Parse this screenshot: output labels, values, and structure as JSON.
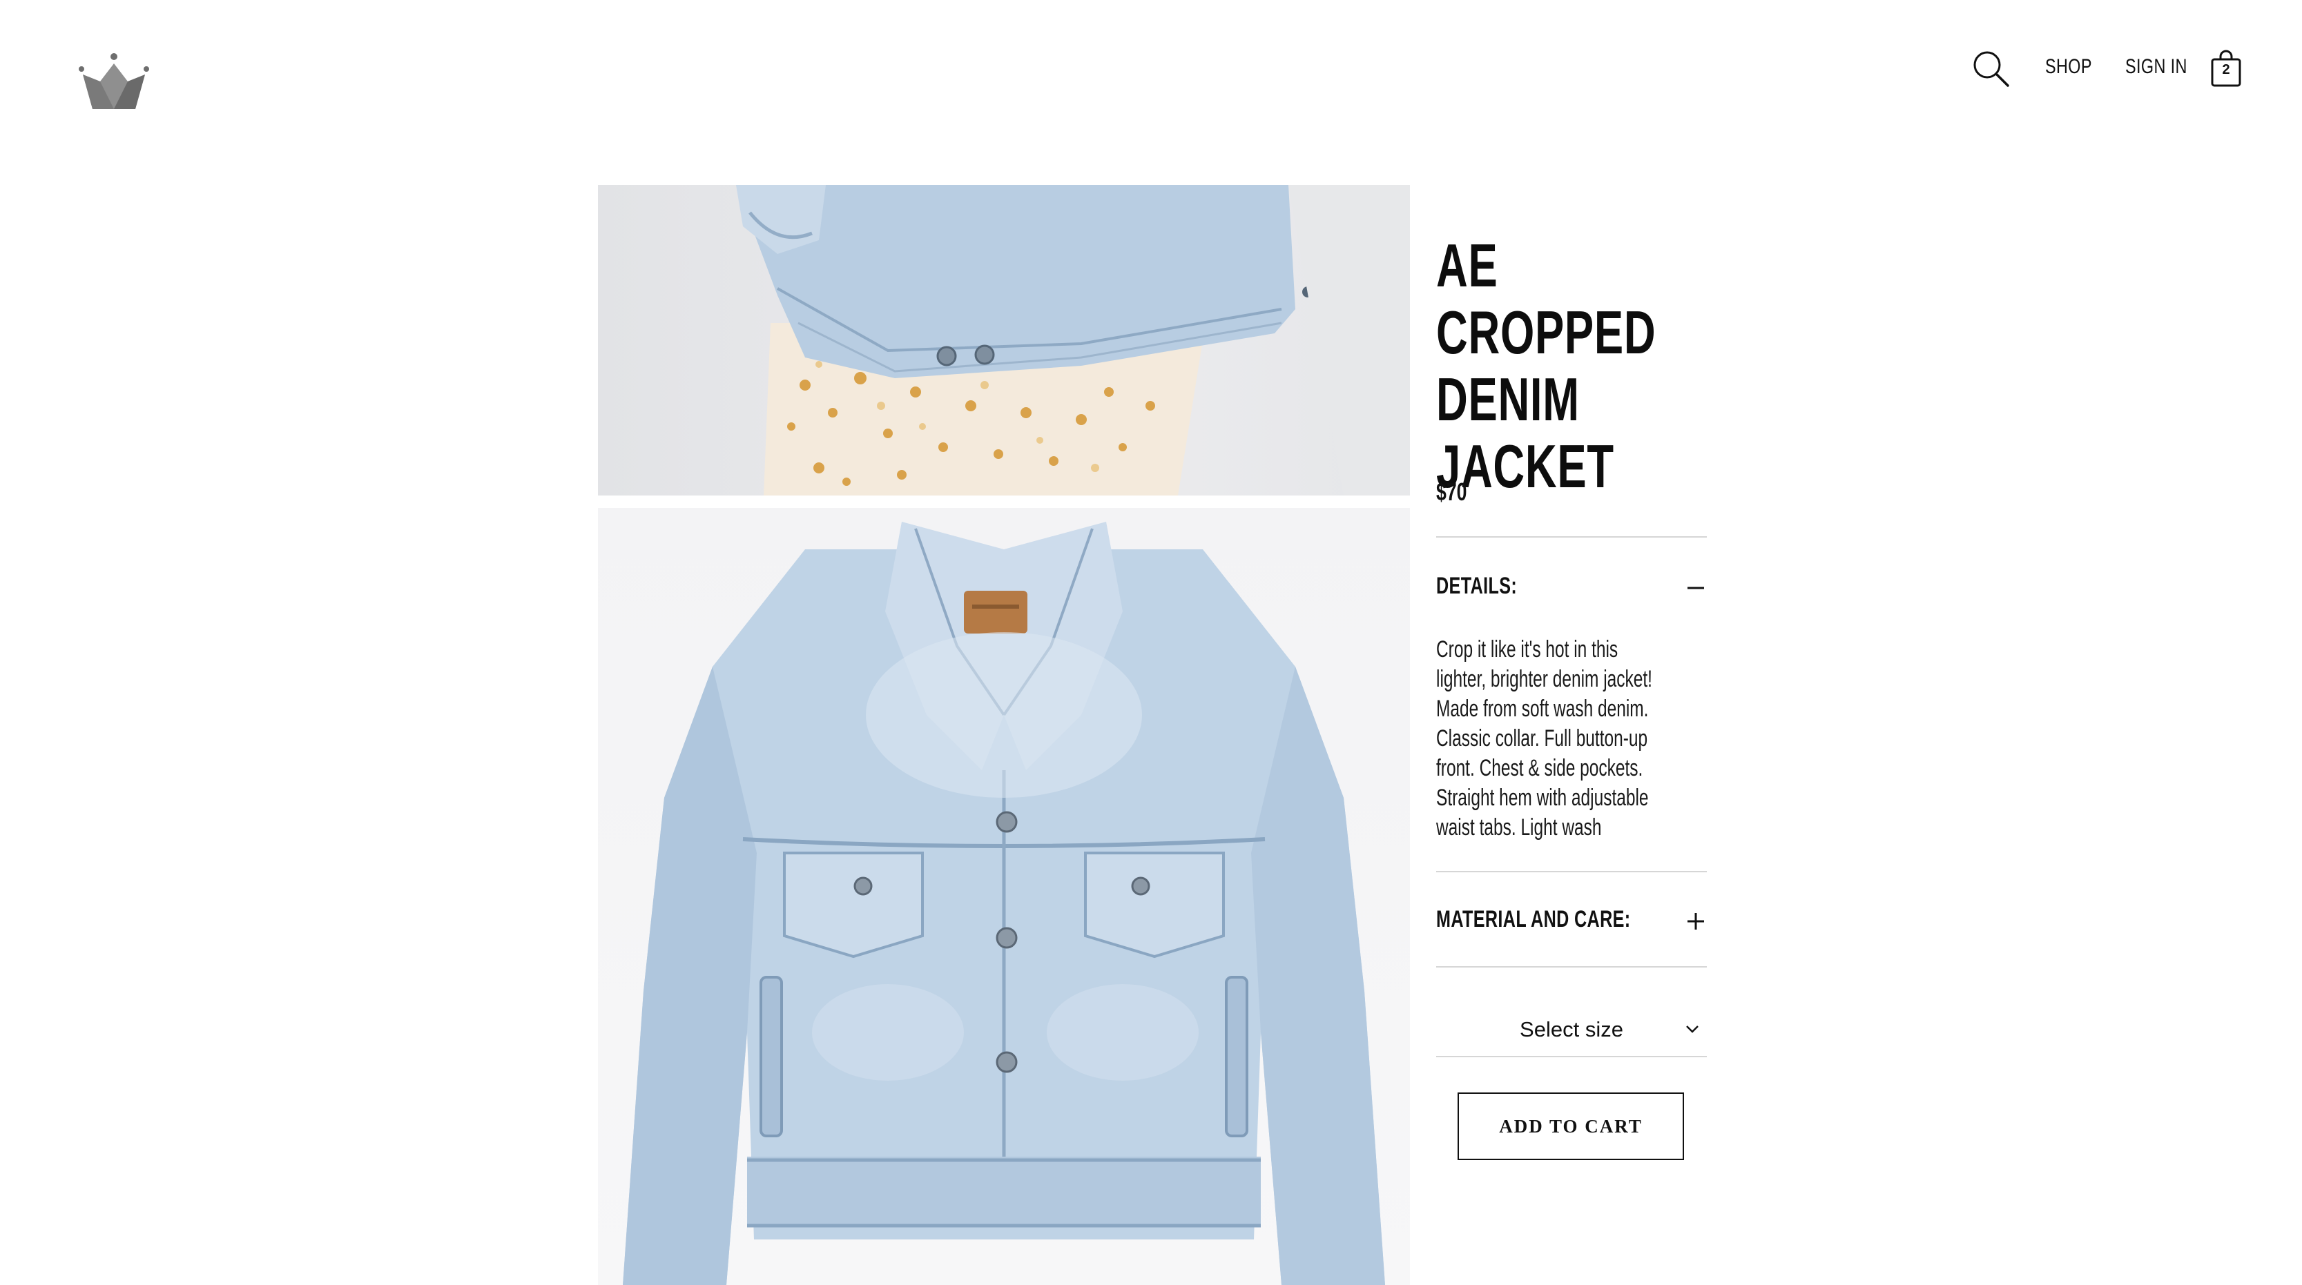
{
  "header": {
    "logo_icon": "crown-logo-icon",
    "search_icon": "search-icon",
    "shop_label": "SHOP",
    "signin_label": "SIGN IN",
    "bag_icon": "shopping-bag-icon",
    "bag_count": "2"
  },
  "gallery": {
    "images": [
      {
        "alt_subject": "denim jacket hem over floral skirt"
      },
      {
        "alt_subject": "light wash cropped denim jacket flat lay"
      }
    ]
  },
  "product": {
    "title_lines": [
      "AE CROPPED",
      "DENIM",
      "JACKET"
    ],
    "price": "$70",
    "details_heading": "DETAILS:",
    "details_toggle": "minus-icon",
    "details_text_lines": [
      "Crop it like it's hot in this",
      "lighter, brighter denim jacket!",
      "Made from soft wash denim.",
      "Classic collar. Full button-up",
      "front. Chest & side pockets.",
      "Straight hem with adjustable",
      "waist tabs. Light wash"
    ],
    "material_heading": "MATERIAL AND CARE:",
    "material_toggle": "plus-icon",
    "size_select": {
      "selected": "Select size",
      "icon": "chevron-down-icon"
    },
    "add_to_cart_label": "ADD TO CART"
  },
  "colors": {
    "text": "#111111",
    "divider": "#d6d6d6",
    "denim": "#b9cde0",
    "background": "#ffffff"
  }
}
